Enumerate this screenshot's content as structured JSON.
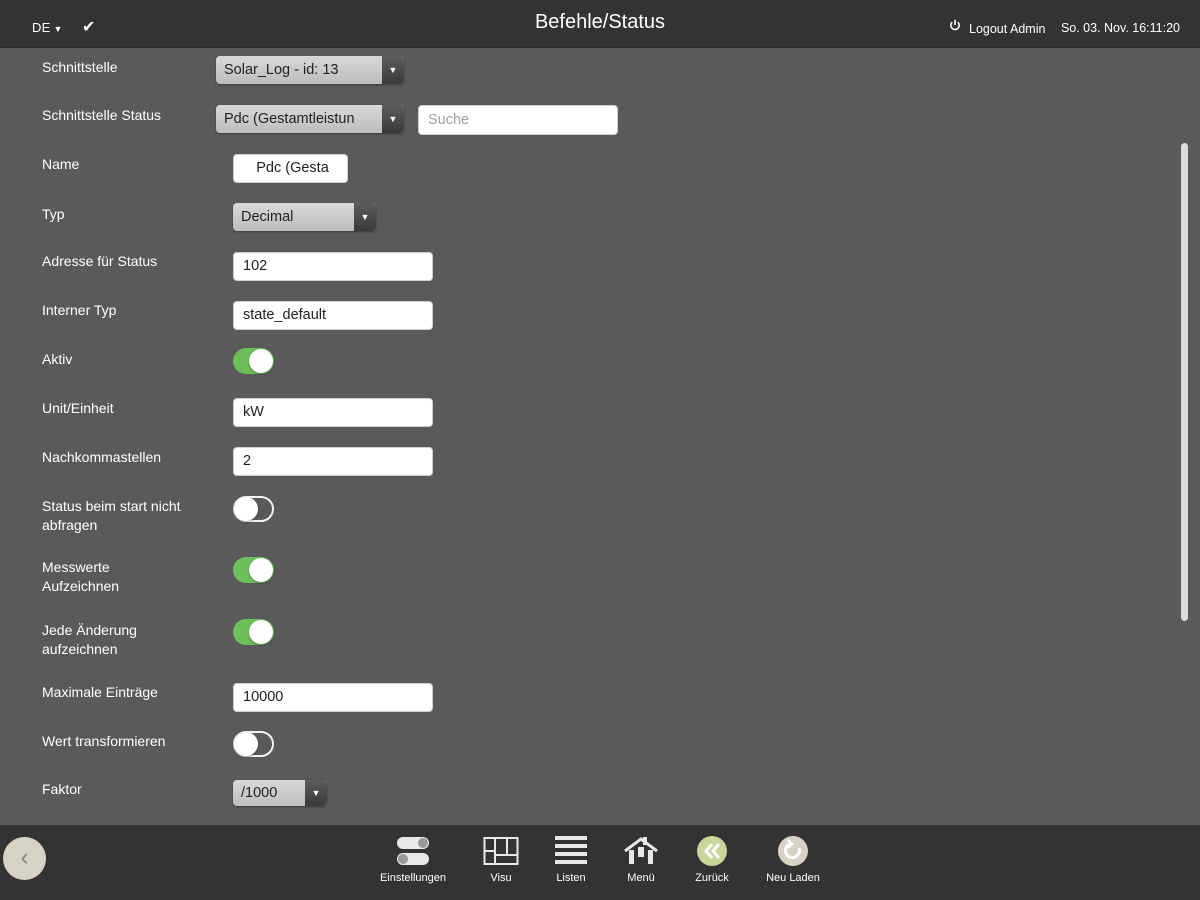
{
  "header": {
    "language": "DE",
    "title": "Befehle/Status",
    "logout": "Logout Admin",
    "datetime": "So. 03. Nov. 16:11:20"
  },
  "form": {
    "schnittstelle": {
      "label": "Schnittstelle",
      "value": "Solar_Log - id: 13"
    },
    "schnittstelle_status": {
      "label": "Schnittstelle Status",
      "value": "Pdc (Gestamtleistun",
      "search_placeholder": "Suche"
    },
    "name": {
      "label": "Name",
      "value": "Pdc (Gesta"
    },
    "typ": {
      "label": "Typ",
      "value": "Decimal"
    },
    "adresse": {
      "label": "Adresse für Status",
      "value": "102"
    },
    "interner_typ": {
      "label": "Interner Typ",
      "value": "state_default"
    },
    "aktiv": {
      "label": "Aktiv",
      "on": true
    },
    "einheit": {
      "label": "Unit/Einheit",
      "value": "kW"
    },
    "nachkomma": {
      "label": "Nachkommastellen",
      "value": "2"
    },
    "status_start": {
      "label_line1": "Status beim start nicht",
      "label_line2": "abfragen",
      "on": false
    },
    "messwerte": {
      "label_line1": "Messwerte",
      "label_line2": "Aufzeichnen",
      "on": true
    },
    "jede_aenderung": {
      "label_line1": "Jede Änderung",
      "label_line2": "aufzeichnen",
      "on": true
    },
    "max_eintraege": {
      "label": "Maximale Einträge",
      "value": "10000"
    },
    "wert_transformieren": {
      "label": "Wert transformieren",
      "on": false
    },
    "faktor": {
      "label": "Faktor",
      "value": "/1000"
    }
  },
  "bottom_nav": [
    {
      "label": "Einstellungen",
      "icon": "settings-icon"
    },
    {
      "label": "Visu",
      "icon": "floorplan-icon"
    },
    {
      "label": "Listen",
      "icon": "list-icon"
    },
    {
      "label": "Menü",
      "icon": "house-menu-icon"
    },
    {
      "label": "Zurück",
      "icon": "back-arrows-icon"
    },
    {
      "label": "Neu Laden",
      "icon": "reload-icon"
    }
  ],
  "colors": {
    "background": "#5a5a5a",
    "bar": "#333333",
    "toggle_on": "#6dbf5a"
  }
}
